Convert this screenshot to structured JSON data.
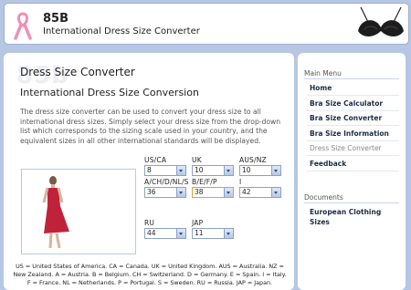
{
  "header": {
    "site_name": "85B",
    "subtitle": "International Dress Size Converter",
    "logo_icon": "pink-ribbon-icon",
    "image_icon": "bra-image"
  },
  "main": {
    "watermark": "85b",
    "title": "Dress Size Converter",
    "section_title": "International Dress Size Conversion",
    "intro": "The dress size converter can be used to convert your dress size to all international dress sizes. Simply select your dress size from the drop-down list which corresponds to the sizing scale used in your country, and the equivalent sizes in all other international standards will be displayed.",
    "fields": [
      {
        "label": "US/CA",
        "value": "8"
      },
      {
        "label": "UK",
        "value": "10"
      },
      {
        "label": "AUS/NZ",
        "value": "10"
      },
      {
        "label": "A/CH/D/NL/S",
        "value": "36"
      },
      {
        "label": "B/E/F/P",
        "value": "38"
      },
      {
        "label": "I",
        "value": "42"
      },
      {
        "label": "RU",
        "value": "44"
      },
      {
        "label": "JAP",
        "value": "11"
      }
    ],
    "legend": "US = United States of America. CA = Canada. UK = United Kingdom. AUS = Australia. NZ = New Zealand. A = Austria. B = Belgium. CH = Switzerland. D = Germany. E = Spain. I = Italy. F = France. NL = Netherlands. P = Portugal. S = Sweden. RU = Russia. JAP = Japan."
  },
  "sidebar": {
    "menu_heading": "Main Menu",
    "menu": [
      {
        "label": "Home"
      },
      {
        "label": "Bra Size Calculator"
      },
      {
        "label": "Bra Size Converter"
      },
      {
        "label": "Bra Size Information"
      },
      {
        "label": "Dress Size Converter"
      },
      {
        "label": "Feedback"
      }
    ],
    "docs_heading": "Documents",
    "docs": [
      {
        "label": "European Clothing Sizes"
      }
    ]
  },
  "colors": {
    "background": "#b7c7e3",
    "dress": "#c0223a",
    "ribbon": "#f08fb6",
    "link": "#1e2b44"
  }
}
